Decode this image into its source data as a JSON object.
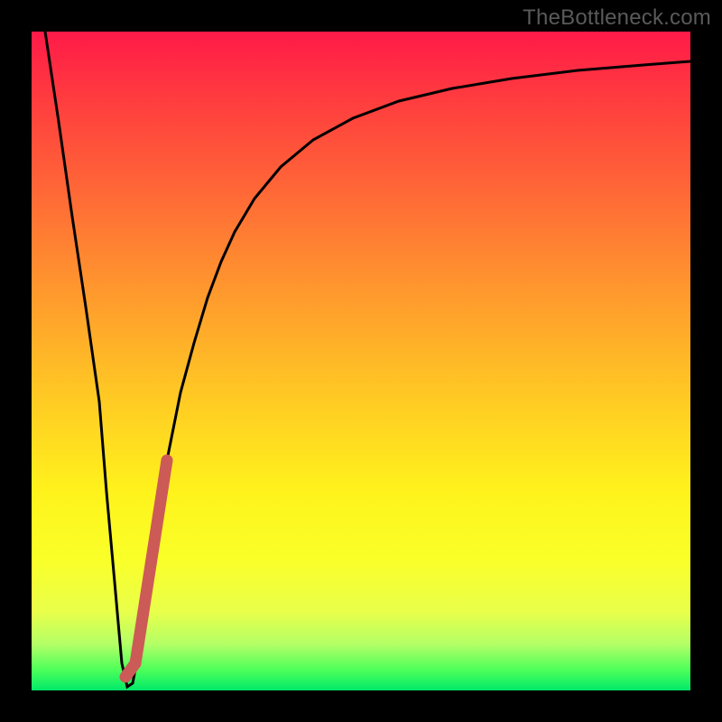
{
  "watermark": "TheBottleneck.com",
  "colors": {
    "frame": "#000000",
    "curve_stroke": "#000000",
    "marker_stroke": "#cc5a57",
    "gradient_top": "#ff1a48",
    "gradient_bottom": "#00e86a"
  },
  "chart_data": {
    "type": "line",
    "title": "",
    "xlabel": "",
    "ylabel": "",
    "xlim": [
      0,
      100
    ],
    "ylim": [
      0,
      100
    ],
    "grid": false,
    "series": [
      {
        "name": "bottleneck-curve",
        "x": [
          2,
          4,
          6,
          8,
          10,
          11,
          12,
          13,
          14,
          15,
          16,
          17,
          18,
          20,
          22,
          24,
          26,
          28,
          30,
          33,
          37,
          42,
          48,
          55,
          63,
          72,
          82,
          92,
          100
        ],
        "y": [
          100,
          86,
          72,
          58,
          44,
          30,
          16,
          4,
          0,
          1,
          7,
          16,
          23,
          35,
          45,
          53,
          60,
          65,
          70,
          75,
          80,
          84,
          87,
          89.5,
          91.5,
          93,
          94.2,
          95,
          95.6
        ]
      }
    ],
    "marker": {
      "name": "highlight-band",
      "x_range": [
        13.5,
        20
      ],
      "y_range": [
        2,
        36
      ],
      "color": "#cc5a57"
    }
  }
}
